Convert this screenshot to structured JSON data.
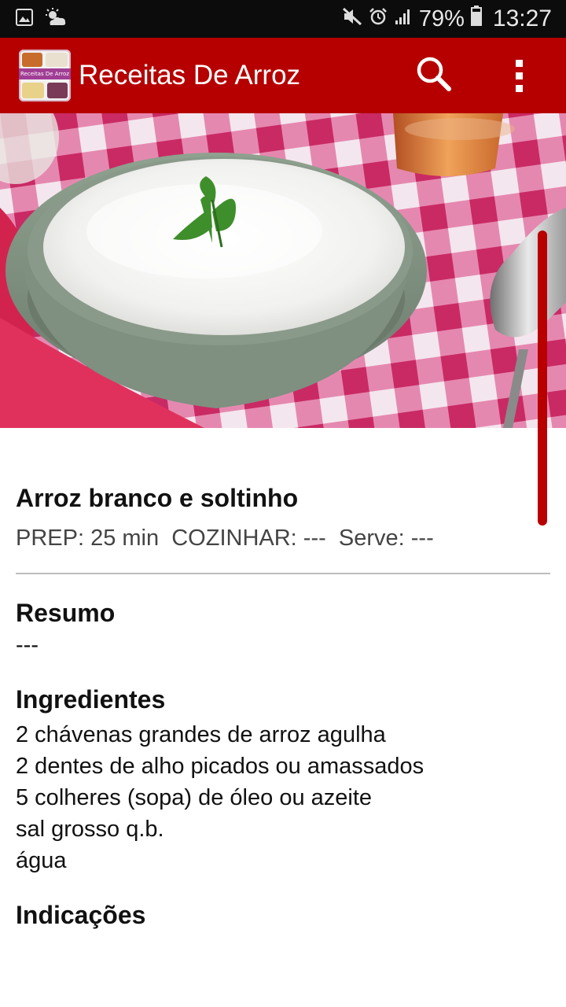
{
  "status_bar": {
    "battery": "79%",
    "time": "13:27"
  },
  "app_bar": {
    "title": "Receitas De Arroz",
    "logo_text": "Receitas De Arroz"
  },
  "recipe": {
    "title": "Arroz branco e soltinho",
    "meta": "PREP: 25 min  COZINHAR: ---  Serve: ---",
    "summary_heading": "Resumo",
    "summary": "---",
    "ingredients_heading": "Ingredientes",
    "ingredients": [
      "2 chávenas grandes de arroz agulha",
      "2 dentes de alho picados ou amassados",
      "5 colheres (sopa) de óleo ou azeite",
      "sal grosso q.b.",
      "água"
    ],
    "instructions_heading": "Indicações"
  },
  "colors": {
    "app_bar": "#b60000",
    "status_bar": "#0c0c0c",
    "scrollbar": "#b80000"
  }
}
